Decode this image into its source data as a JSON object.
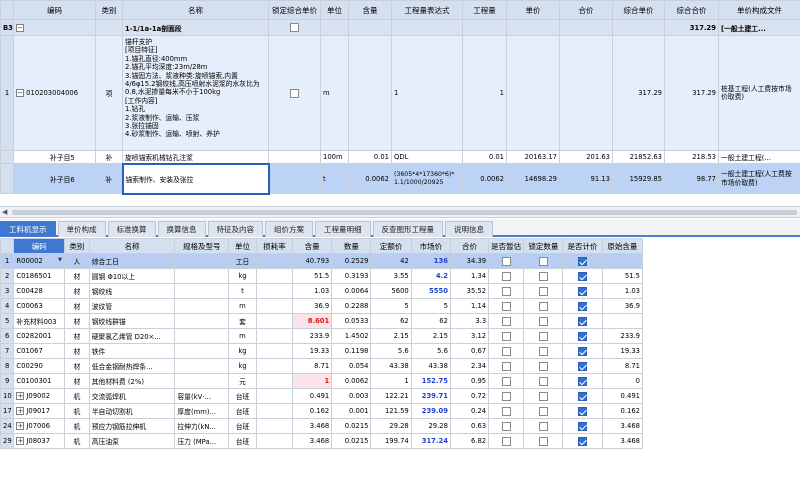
{
  "top_grid": {
    "headers": [
      "编码",
      "类别",
      "名称",
      "锁定综合单价",
      "单位",
      "含量",
      "工程量表达式",
      "工程量",
      "单价",
      "合价",
      "综合单价",
      "综合合价",
      "单价构成文件"
    ],
    "row_b3": {
      "idx": "B3",
      "toggle": "−",
      "name": "1-1/1a-1a剖面段",
      "total": "317.29",
      "file": "[一般土建工..."
    },
    "row_1": {
      "idx": "1",
      "toggle": "−",
      "code": "010203004006",
      "type": "项",
      "description": "锚杆支护\n[项目特征]\n1.锚孔直径:400mm\n2.锚孔平均深度:23m/28m\n3.锚固方法、浆液种类:旋喷锚索,内置4/6φ15.2钢绞线,高压喷射水泥浆的水灰比为0.8,水泥掺量每米不小于100kg\n[工作内容]\n1.钻孔\n2.浆液制作、运输、压浆\n3.张拉锚固\n4.砂浆制作、运输、喷射、养护",
      "unit": "m",
      "expr": "1",
      "qty": "1",
      "unit_composite": "317.29",
      "total_composite": "317.29",
      "file": "桩基工程(人工费按市场价取费)"
    },
    "row_sub1": {
      "label": "补子目5",
      "type": "补",
      "name": "旋喷锚索机械钻孔注浆",
      "unit": "100m",
      "content": "0.01",
      "expr": "QDL",
      "qty": "0.01",
      "price": "20163.17",
      "amount": "201.63",
      "unit_composite": "21852.63",
      "total_composite": "218.53",
      "file": "一般土建工程(..."
    },
    "row_sub2": {
      "label": "补子目6",
      "type": "补",
      "name": "锚索制作、安装及张拉",
      "unit": "t",
      "content": "0.0062",
      "expr": "(3605*4*17360*6)*1.1/1000/20925",
      "qty": "0.0062",
      "price": "14698.29",
      "amount": "91.13",
      "unit_composite": "15929.85",
      "total_composite": "98.77",
      "file": "一般土建工程(人工费按市场价取费)"
    }
  },
  "tabs": [
    "工料机显示",
    "单价构成",
    "标准换算",
    "换算信息",
    "特征及内容",
    "组价方案",
    "工程量明细",
    "反查图形工程量",
    "说明信息"
  ],
  "bottom_grid": {
    "headers": [
      "",
      "编码",
      "类别",
      "名称",
      "规格及型号",
      "单位",
      "损耗率",
      "含量",
      "数量",
      "定额价",
      "市场价",
      "合价",
      "是否暂估",
      "锁定数量",
      "是否计价",
      "原始含量"
    ],
    "rows": [
      {
        "idx": "1",
        "code": "R00002",
        "type": "人",
        "name": "综合工日",
        "spec": "",
        "unit": "工日",
        "loss": "",
        "content": "40.793",
        "qty": "0.2529",
        "quota": "42",
        "market": "136",
        "amount": "34.39",
        "priced": true,
        "orig": "",
        "market_style": "blue",
        "selected": true
      },
      {
        "idx": "2",
        "code": "C0186501",
        "type": "材",
        "name": "圆钢 Φ10以上",
        "spec": "",
        "unit": "kg",
        "loss": "",
        "content": "51.5",
        "qty": "0.3193",
        "quota": "3.55",
        "market": "4.2",
        "amount": "1.34",
        "priced": true,
        "orig": "51.5",
        "market_style": "blue"
      },
      {
        "idx": "3",
        "code": "C00428",
        "type": "材",
        "name": "钢绞线",
        "spec": "",
        "unit": "t",
        "loss": "",
        "content": "1.03",
        "qty": "0.0064",
        "quota": "5600",
        "market": "5550",
        "amount": "35.52",
        "priced": true,
        "orig": "1.03",
        "market_style": "blue"
      },
      {
        "idx": "4",
        "code": "C00063",
        "type": "材",
        "name": "波纹管",
        "spec": "",
        "unit": "m",
        "loss": "",
        "content": "36.9",
        "qty": "0.2288",
        "quota": "5",
        "market": "5",
        "amount": "1.14",
        "priced": true,
        "orig": "36.9",
        "market_style": ""
      },
      {
        "idx": "5",
        "code": "补充材料003",
        "type": "材",
        "name": "钢绞线群锚",
        "spec": "",
        "unit": "套",
        "loss": "",
        "content": "8.601",
        "qty": "0.0533",
        "quota": "62",
        "market": "62",
        "amount": "3.3",
        "priced": true,
        "orig": "",
        "market_style": "",
        "content_style": "red"
      },
      {
        "idx": "6",
        "code": "C0282001",
        "type": "材",
        "name": "硬聚氯乙烯管 D20×...",
        "spec": "",
        "unit": "m",
        "loss": "",
        "content": "233.9",
        "qty": "1.4502",
        "quota": "2.15",
        "market": "2.15",
        "amount": "3.12",
        "priced": true,
        "orig": "233.9",
        "market_style": ""
      },
      {
        "idx": "7",
        "code": "C01067",
        "type": "材",
        "name": "铁件",
        "spec": "",
        "unit": "kg",
        "loss": "",
        "content": "19.33",
        "qty": "0.1198",
        "quota": "5.6",
        "market": "5.6",
        "amount": "0.67",
        "priced": true,
        "orig": "19.33",
        "market_style": ""
      },
      {
        "idx": "8",
        "code": "C00290",
        "type": "材",
        "name": "低合金钢耐热焊条...",
        "spec": "",
        "unit": "kg",
        "loss": "",
        "content": "8.71",
        "qty": "0.054",
        "quota": "43.38",
        "market": "43.38",
        "amount": "2.34",
        "priced": true,
        "orig": "8.71",
        "market_style": ""
      },
      {
        "idx": "9",
        "code": "C0100301",
        "type": "材",
        "name": "其他材料费 (2%)",
        "spec": "",
        "unit": "元",
        "loss": "",
        "content": "1",
        "qty": "0.0062",
        "quota": "1",
        "market": "152.75",
        "amount": "0.95",
        "priced": true,
        "orig": "0",
        "market_style": "blue",
        "content_style": "red"
      },
      {
        "idx": "10",
        "code": "J09002",
        "type": "机",
        "name": "交流弧焊机",
        "spec": "容量(kV·...",
        "unit": "台班",
        "loss": "",
        "content": "0.491",
        "qty": "0.003",
        "quota": "122.21",
        "market": "239.71",
        "amount": "0.72",
        "priced": true,
        "orig": "0.491",
        "market_style": "blue",
        "expand": true
      },
      {
        "idx": "17",
        "code": "J09017",
        "type": "机",
        "name": "半自动切割机",
        "spec": "厚度(mm)...",
        "unit": "台班",
        "loss": "",
        "content": "0.162",
        "qty": "0.001",
        "quota": "121.59",
        "market": "239.09",
        "amount": "0.24",
        "priced": true,
        "orig": "0.162",
        "market_style": "blue",
        "expand": true
      },
      {
        "idx": "24",
        "code": "J07006",
        "type": "机",
        "name": "预应力钢筋拉伸机",
        "spec": "拉伸力(kN...",
        "unit": "台班",
        "loss": "",
        "content": "3.468",
        "qty": "0.0215",
        "quota": "29.28",
        "market": "29.28",
        "amount": "0.63",
        "priced": true,
        "orig": "3.468",
        "market_style": "",
        "expand": true
      },
      {
        "idx": "29",
        "code": "J08037",
        "type": "机",
        "name": "高压油泵",
        "spec": "压力 (MPa...",
        "unit": "台班",
        "loss": "",
        "content": "3.468",
        "qty": "0.0215",
        "quota": "199.74",
        "market": "317.24",
        "amount": "6.82",
        "priced": true,
        "orig": "3.468",
        "market_style": "blue",
        "expand": true
      }
    ]
  }
}
